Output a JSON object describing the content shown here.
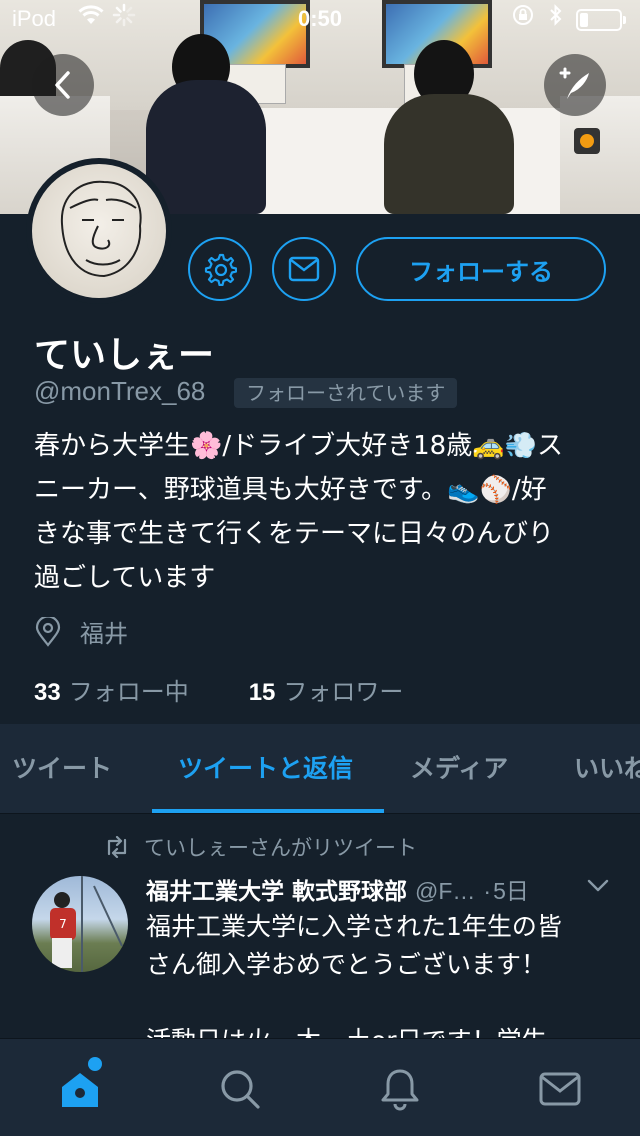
{
  "status_bar": {
    "carrier": "iPod",
    "time": "0:50"
  },
  "profile": {
    "name": "ていしぇー",
    "handle": "@monTrex_68",
    "follows_you": "フォローされています",
    "follow_button": "フォローする",
    "bio_lines": [
      "春から大学生🌸/ドライブ大好き18歳🚕💨ス",
      "ニーカー、野球道具も大好きです。👟⚾/好",
      "きな事で生きて行くをテーマに日々のんびり",
      "過ごしています"
    ],
    "location": "福井",
    "following_count": "33",
    "following_label": "フォロー中",
    "followers_count": "15",
    "followers_label": "フォロワー"
  },
  "tabs": [
    {
      "label": "ツイート",
      "active": false
    },
    {
      "label": "ツイートと返信",
      "active": true
    },
    {
      "label": "メディア",
      "active": false
    },
    {
      "label": "いいね",
      "active": false
    }
  ],
  "tweet": {
    "retweet_note": "ていしぇーさんがリツイート",
    "author_name": "福井工業大学 軟式野球部",
    "author_handle": "@F…",
    "time": "5日",
    "text_lines": [
      "福井工業大学に入学された1年生の皆",
      "さん御入学おめでとうございます！",
      "",
      "活動日は火、木、土or日です！学生"
    ]
  },
  "colors": {
    "accent": "#1da1f2",
    "background": "#15202b",
    "panel": "#1c2938",
    "secondary_text": "#8899a6"
  },
  "icons": {
    "back": "chevron-left-icon",
    "compose": "compose-tweet-icon",
    "settings": "gear-icon",
    "message": "envelope-icon",
    "location": "map-pin-icon",
    "retweet": "retweet-icon",
    "nav": [
      "home-icon",
      "search-icon",
      "bell-icon",
      "envelope-icon"
    ]
  }
}
